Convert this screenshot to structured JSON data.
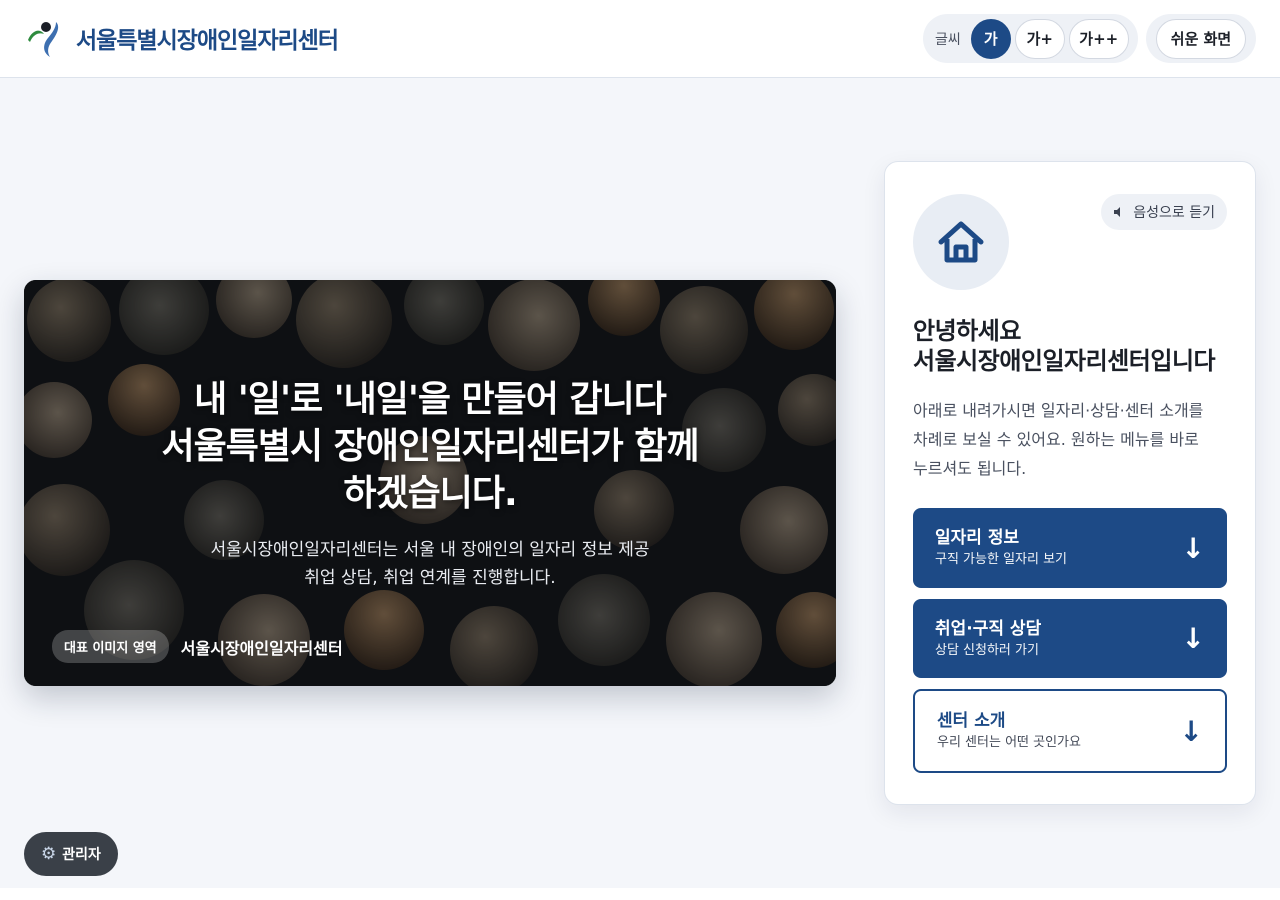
{
  "header": {
    "site_name": "서울특별시장애인일자리센터",
    "font_label": "글씨",
    "font_sizes": [
      "가",
      "가+",
      "가++"
    ],
    "easy_screen": "쉬운 화면"
  },
  "hero": {
    "title_lines": [
      "내 '일'로 '내일'을 만들어 갑니다",
      "서울특별시 장애인일자리센터가 함께",
      "하겠습니다."
    ],
    "sub_lines": [
      "서울시장애인일자리센터는 서울 내 장애인의 일자리 정보 제공",
      "취업 상담, 취업 연계를 진행합니다."
    ],
    "badge": "대표 이미지 영역",
    "caption": "서울시장애인일자리센터"
  },
  "card": {
    "listen": "음성으로 듣기",
    "title_lines": [
      "안녕하세요",
      "서울시장애인일자리센터입니다"
    ],
    "desc_lines": [
      "아래로 내려가시면 일자리·상담·센터 소개를",
      "차례로 보실 수 있어요. 원하는 메뉴를 바로",
      "누르셔도 됩니다."
    ],
    "buttons": [
      {
        "title": "일자리 정보",
        "sub": "구직 가능한 일자리 보기",
        "arrow": "↓"
      },
      {
        "title": "취업·구직 상담",
        "sub": "상담 신청하러 가기",
        "arrow": "↓"
      },
      {
        "title": "센터 소개",
        "sub": "우리 센터는 어떤 곳인가요",
        "arrow": "↓"
      }
    ]
  },
  "admin": {
    "label": "관리자",
    "icon": "gear-icon"
  },
  "colors": {
    "brand": "#1d4a86",
    "background": "#f4f6fa"
  }
}
